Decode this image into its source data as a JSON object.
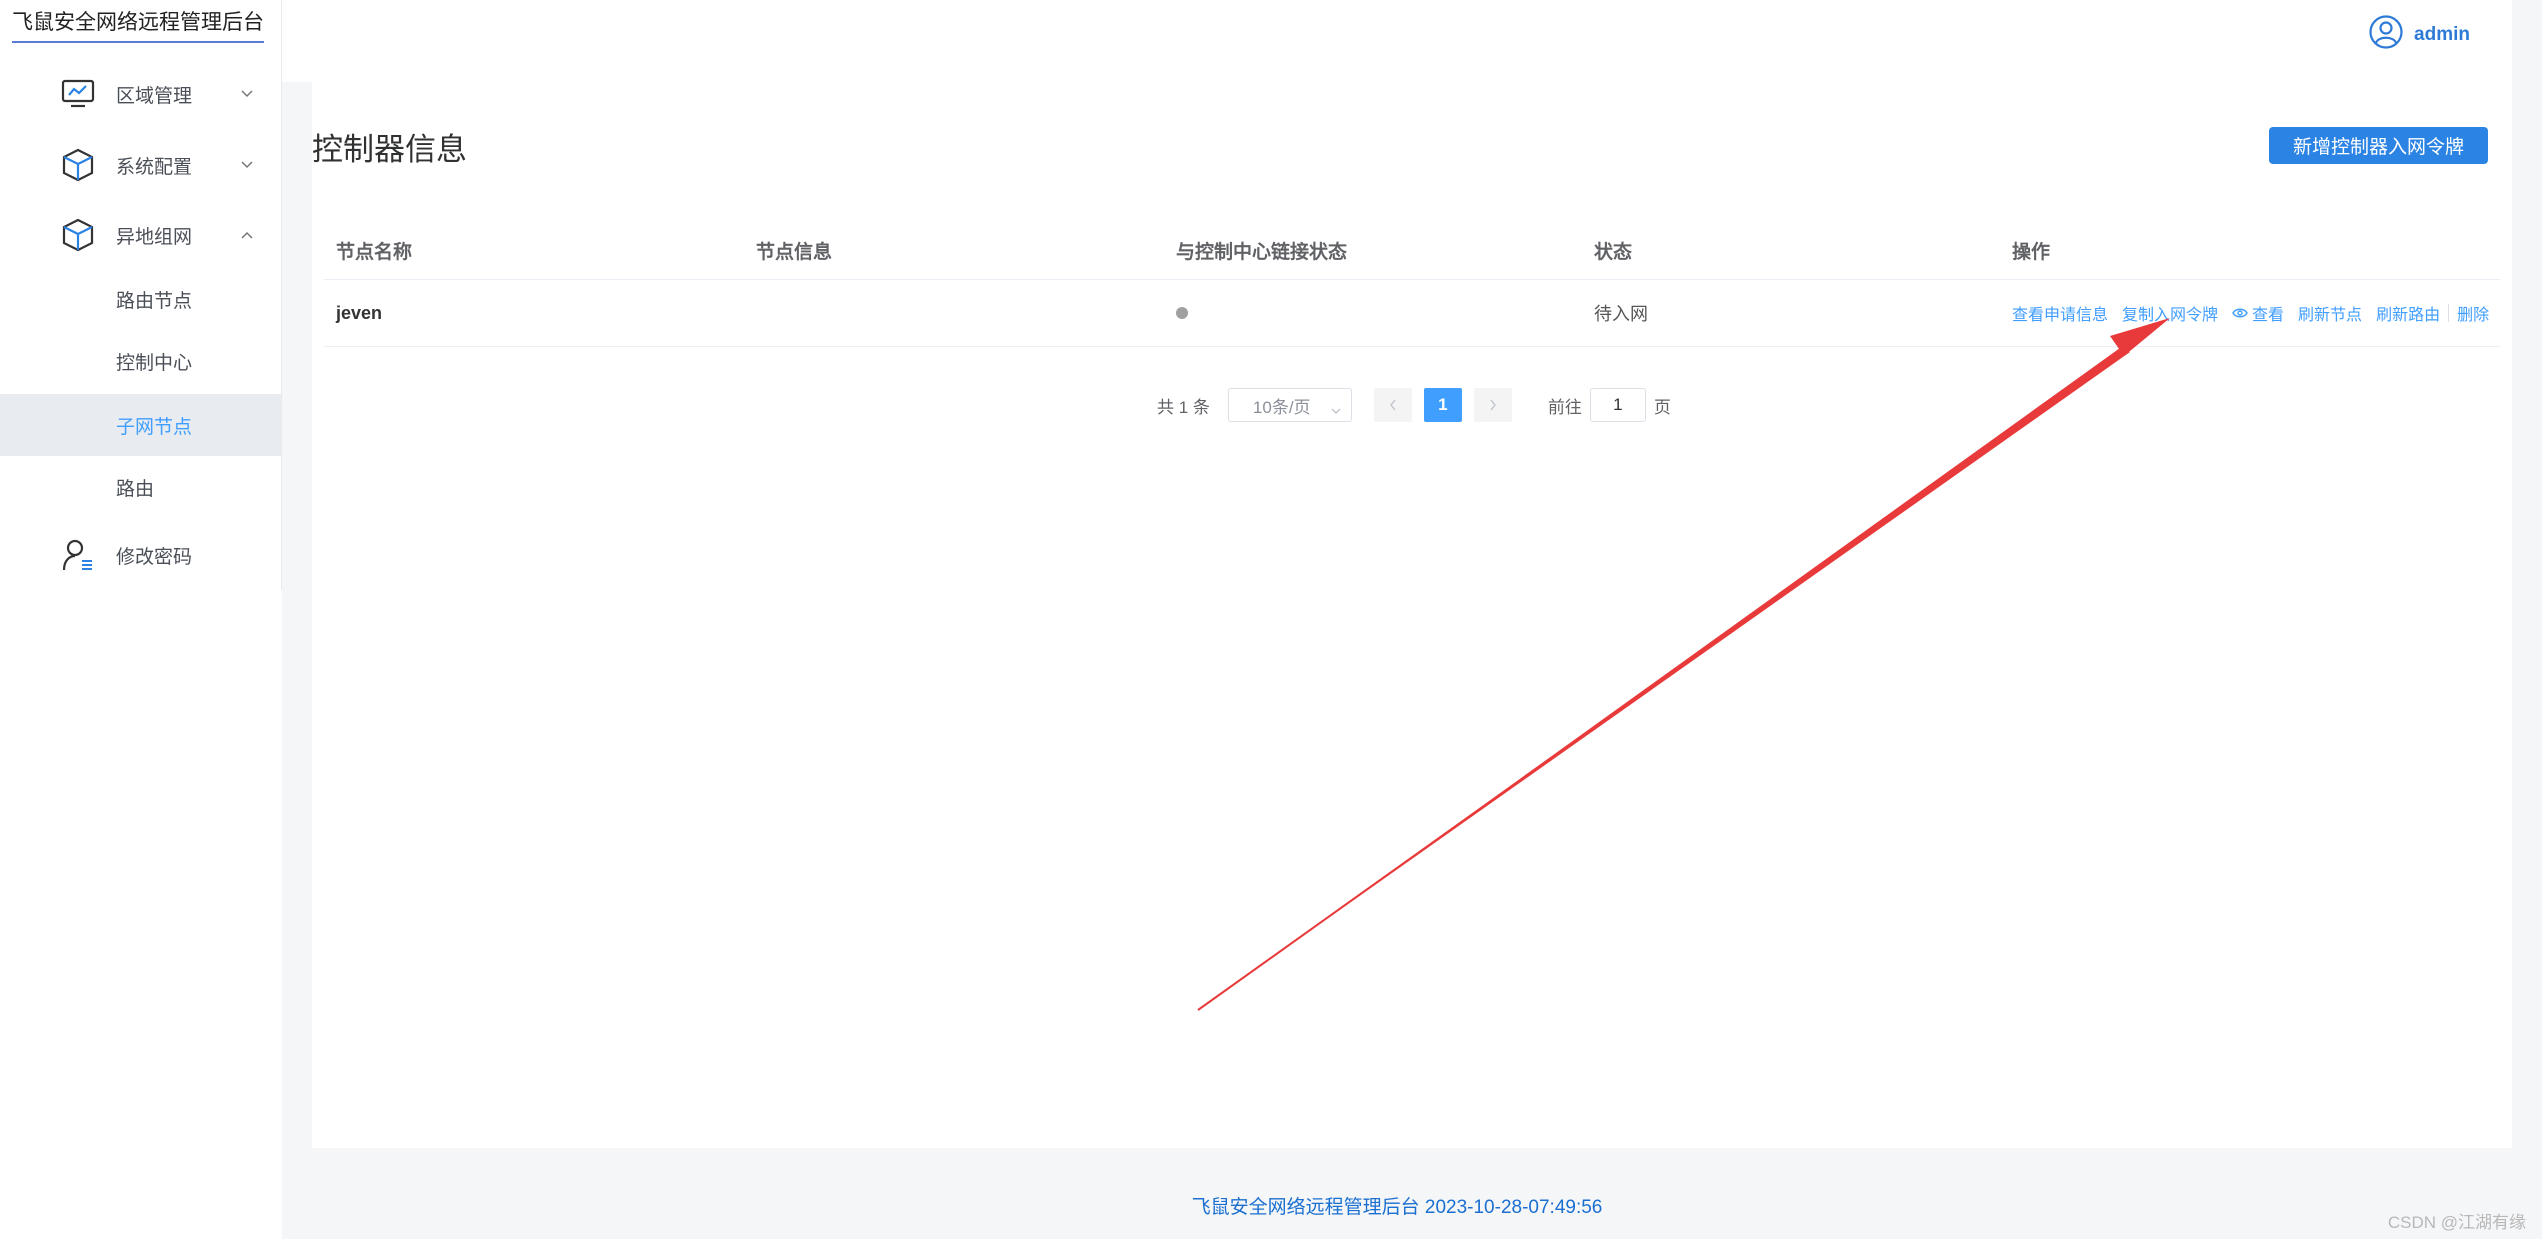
{
  "app": {
    "brand": "飞鼠安全网络远程管理后台"
  },
  "sidebar": {
    "items": [
      {
        "label": "区域管理",
        "icon": "monitor-chart-icon",
        "expanded": false
      },
      {
        "label": "系统配置",
        "icon": "cube-icon",
        "expanded": false
      },
      {
        "label": "异地组网",
        "icon": "cube-icon",
        "expanded": true
      }
    ],
    "sub_items": [
      {
        "label": "路由节点"
      },
      {
        "label": "控制中心"
      },
      {
        "label": "子网节点",
        "active": true
      },
      {
        "label": "路由"
      }
    ],
    "password": {
      "label": "修改密码",
      "icon": "user-key-icon"
    }
  },
  "header": {
    "user": "admin"
  },
  "main": {
    "title": "控制器信息",
    "add_button": "新增控制器入网令牌",
    "table": {
      "columns": [
        "节点名称",
        "节点信息",
        "与控制中心链接状态",
        "状态",
        "操作"
      ],
      "rows": [
        {
          "name": "jeven",
          "info": "",
          "link_status": "offline",
          "status": "待入网",
          "ops": {
            "view_apply": "查看申请信息",
            "copy_token": "复制入网令牌",
            "view": "查看",
            "refresh_node": "刷新节点",
            "refresh_route": "刷新路由",
            "delete": "删除"
          }
        }
      ]
    },
    "pagination": {
      "total": "共 1 条",
      "page_size": "10条/页",
      "current_page": "1",
      "goto_label": "前往",
      "goto_value": "1",
      "page_unit": "页"
    }
  },
  "footer": {
    "text": "飞鼠安全网络远程管理后台 2023-10-28-07:49:56"
  },
  "watermark": "CSDN @江湖有缘",
  "colors": {
    "primary": "#409eff",
    "button": "#2b83e4",
    "annotation_arrow": "#e83a3a",
    "status_offline": "#a0a0a0"
  }
}
